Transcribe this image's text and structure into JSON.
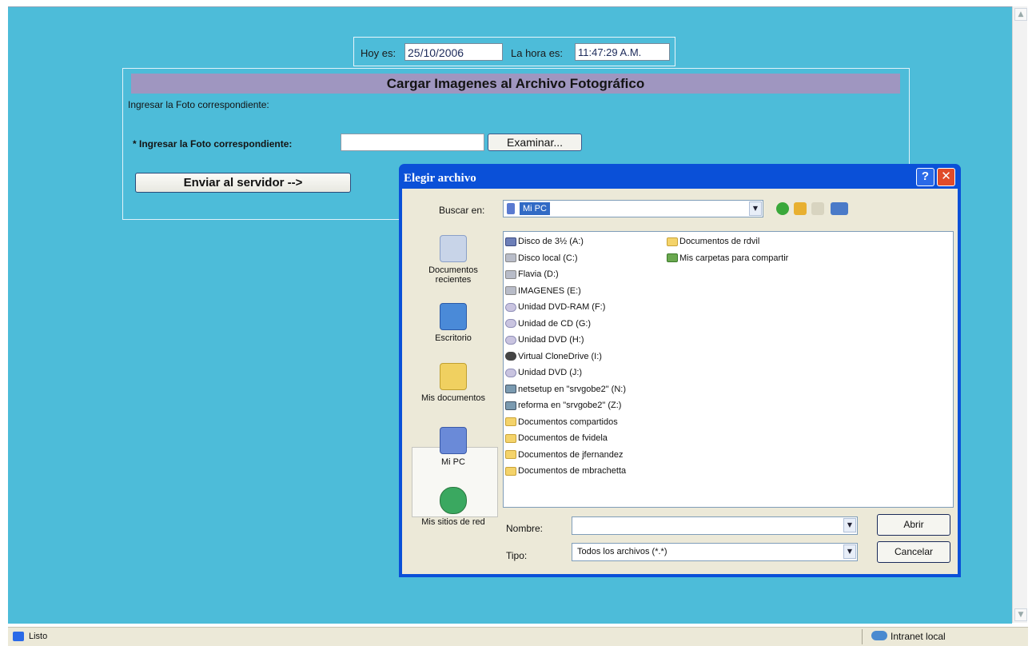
{
  "datetime": {
    "today_label": "Hoy es:",
    "today_value": "25/10/2006",
    "time_label": "La hora es:",
    "time_value": "11:47:29 A.M."
  },
  "form": {
    "title": "Cargar Imagenes al Archivo Fotográfico",
    "intro": "Ingresar la Foto correspondiente:",
    "file_label": "* Ingresar la Foto correspondiente:",
    "file_value": "",
    "browse_label": "Examinar...",
    "send_label": "Enviar al servidor -->"
  },
  "dialog": {
    "title": "Elegir archivo",
    "help": "?",
    "close": "✕",
    "look_in_label": "Buscar en:",
    "look_in_value": "Mi PC",
    "places": [
      {
        "label": "Documentos recientes",
        "icon": "recent-documents-icon"
      },
      {
        "label": "Escritorio",
        "icon": "desktop-icon"
      },
      {
        "label": "Mis documentos",
        "icon": "my-documents-icon"
      },
      {
        "label": "Mi PC",
        "icon": "my-computer-icon"
      },
      {
        "label": "Mis sitios de red",
        "icon": "network-places-icon"
      }
    ],
    "items_col1": [
      {
        "label": "Disco de 3½ (A:)",
        "icon": "floppy"
      },
      {
        "label": "Disco local (C:)",
        "icon": "drive"
      },
      {
        "label": "Flavia (D:)",
        "icon": "drive"
      },
      {
        "label": "IMAGENES (E:)",
        "icon": "drive"
      },
      {
        "label": "Unidad DVD-RAM (F:)",
        "icon": "cd"
      },
      {
        "label": "Unidad de CD (G:)",
        "icon": "cd"
      },
      {
        "label": "Unidad DVD (H:)",
        "icon": "cd"
      },
      {
        "label": "Virtual CloneDrive (I:)",
        "icon": "virtual"
      },
      {
        "label": "Unidad DVD (J:)",
        "icon": "cd"
      },
      {
        "label": "netsetup en \"srvgobe2\" (N:)",
        "icon": "net"
      },
      {
        "label": "reforma en \"srvgobe2\" (Z:)",
        "icon": "net"
      },
      {
        "label": "Documentos compartidos",
        "icon": "folder"
      },
      {
        "label": "Documentos de fvidela",
        "icon": "folder"
      },
      {
        "label": "Documentos de jfernandez",
        "icon": "folder"
      },
      {
        "label": "Documentos de mbrachetta",
        "icon": "folder"
      }
    ],
    "items_col2": [
      {
        "label": "Documentos de rdvil",
        "icon": "folder"
      },
      {
        "label": "Mis carpetas para compartir",
        "icon": "share"
      }
    ],
    "name_label": "Nombre:",
    "name_value": "",
    "type_label": "Tipo:",
    "type_value": "Todos los archivos (*.*)",
    "open_label": "Abrir",
    "cancel_label": "Cancelar"
  },
  "statusbar": {
    "status": "Listo",
    "zone": "Intranet local"
  }
}
